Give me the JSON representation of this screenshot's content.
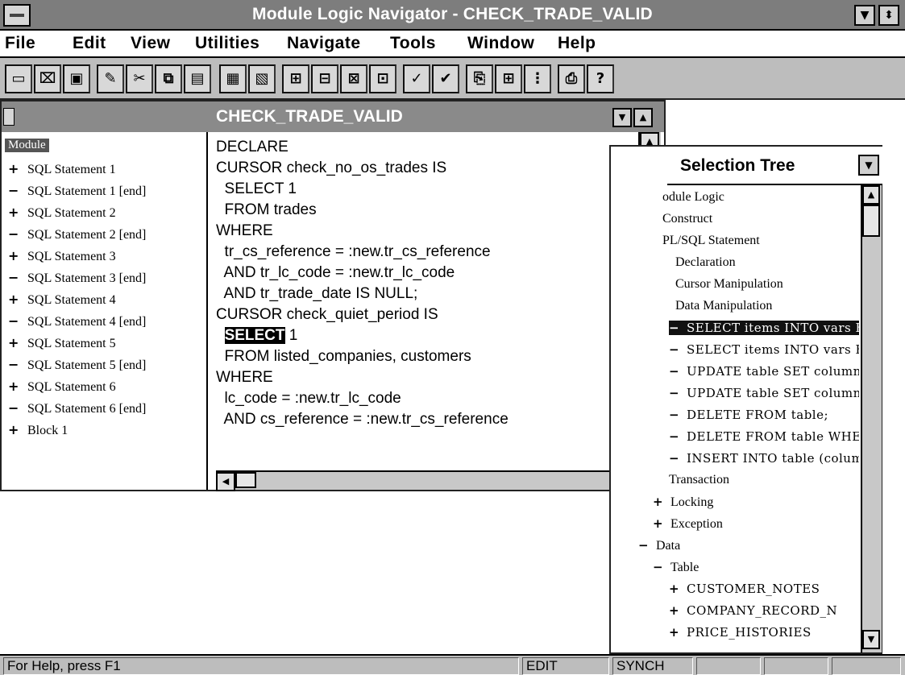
{
  "window": {
    "title": "Module Logic Navigator - CHECK_TRADE_VALID",
    "min_icon": "minimize-icon",
    "max_icon": "maximize-icon"
  },
  "menu": [
    "File",
    "Edit",
    "View",
    "Utilities",
    "Navigate",
    "Tools",
    "Window",
    "Help"
  ],
  "toolbar": {
    "icons": [
      "new-file-icon",
      "open-folder-icon",
      "save-disk-icon",
      "edit-icon",
      "cut-scissors-icon",
      "copy-icon",
      "paste-icon",
      "table-icon",
      "table-link-icon",
      "expand-icon",
      "collapse-icon",
      "expand-all-icon",
      "collapse-all-icon",
      "check-icon",
      "check-all-icon",
      "generate-icon",
      "report-icon",
      "structure-icon",
      "print-icon",
      "help-icon"
    ],
    "help_glyph": "?"
  },
  "module_window": {
    "title": "CHECK_TRADE_VALID",
    "tree_root": "Module",
    "tree": [
      {
        "sym": "+",
        "label": "SQL Statement 1"
      },
      {
        "sym": "−",
        "label": "SQL Statement 1 [end]"
      },
      {
        "sym": "+",
        "label": "SQL Statement 2"
      },
      {
        "sym": "−",
        "label": "SQL Statement 2 [end]"
      },
      {
        "sym": "+",
        "label": "SQL Statement 3"
      },
      {
        "sym": "−",
        "label": "SQL Statement 3 [end]"
      },
      {
        "sym": "+",
        "label": "SQL Statement 4"
      },
      {
        "sym": "−",
        "label": "SQL Statement 4 [end]"
      },
      {
        "sym": "+",
        "label": "SQL Statement 5"
      },
      {
        "sym": "−",
        "label": "SQL Statement 5 [end]"
      },
      {
        "sym": "+",
        "label": "SQL Statement 6"
      },
      {
        "sym": "−",
        "label": "SQL Statement 6 [end]"
      },
      {
        "sym": "+",
        "label": "Block 1"
      }
    ],
    "code": [
      "DECLARE",
      "CURSOR check_no_os_trades IS",
      "  SELECT 1",
      "  FROM trades",
      "WHERE",
      "  tr_cs_reference = :new.tr_cs_reference",
      "  AND tr_lc_code = :new.tr_lc_code",
      "  AND tr_trade_date IS NULL;",
      "CURSOR check_quiet_period IS",
      "",
      "  FROM listed_companies, customers",
      "WHERE",
      "  lc_code = :new.tr_lc_code",
      "  AND cs_reference = :new.tr_cs_reference"
    ],
    "code_line10_highlight": "SELECT",
    "code_line10_rest": " 1"
  },
  "selection_tree": {
    "title": "Selection Tree",
    "items": [
      {
        "sym": "",
        "label": "odule Logic",
        "mono": false
      },
      {
        "sym": "",
        "label": "Construct",
        "mono": false
      },
      {
        "sym": "",
        "label": "PL/SQL Statement",
        "mono": false
      },
      {
        "sym": "",
        "label": "Declaration",
        "mono": false
      },
      {
        "sym": "",
        "label": "Cursor Manipulation",
        "mono": false
      },
      {
        "sym": "",
        "label": "Data Manipulation",
        "mono": false
      },
      {
        "sym": "−",
        "label": "SELECT items INTO vars F",
        "mono": true,
        "selected": true
      },
      {
        "sym": "−",
        "label": "SELECT items INTO vars F",
        "mono": true
      },
      {
        "sym": "−",
        "label": "UPDATE table SET column_",
        "mono": true
      },
      {
        "sym": "−",
        "label": "UPDATE table SET column_",
        "mono": true
      },
      {
        "sym": "−",
        "label": "DELETE FROM table;",
        "mono": true
      },
      {
        "sym": "−",
        "label": "DELETE FROM table WHE",
        "mono": true
      },
      {
        "sym": "−",
        "label": "INSERT INTO table (colum",
        "mono": true
      },
      {
        "sym": "",
        "label": "Transaction",
        "mono": false
      },
      {
        "sym": "+",
        "label": "Locking",
        "mono": false
      },
      {
        "sym": "+",
        "label": "Exception",
        "mono": false
      },
      {
        "sym": "−",
        "label": "Data",
        "mono": false
      },
      {
        "sym": "−",
        "label": "Table",
        "mono": false
      },
      {
        "sym": "+",
        "label": "CUSTOMER_NOTES",
        "mono": true
      },
      {
        "sym": "+",
        "label": "COMPANY_RECORD_N",
        "mono": true
      },
      {
        "sym": "+",
        "label": "PRICE_HISTORIES",
        "mono": true
      }
    ]
  },
  "status": {
    "help": "For Help, press F1",
    "mode": "EDIT",
    "sync": "SYNCH"
  }
}
